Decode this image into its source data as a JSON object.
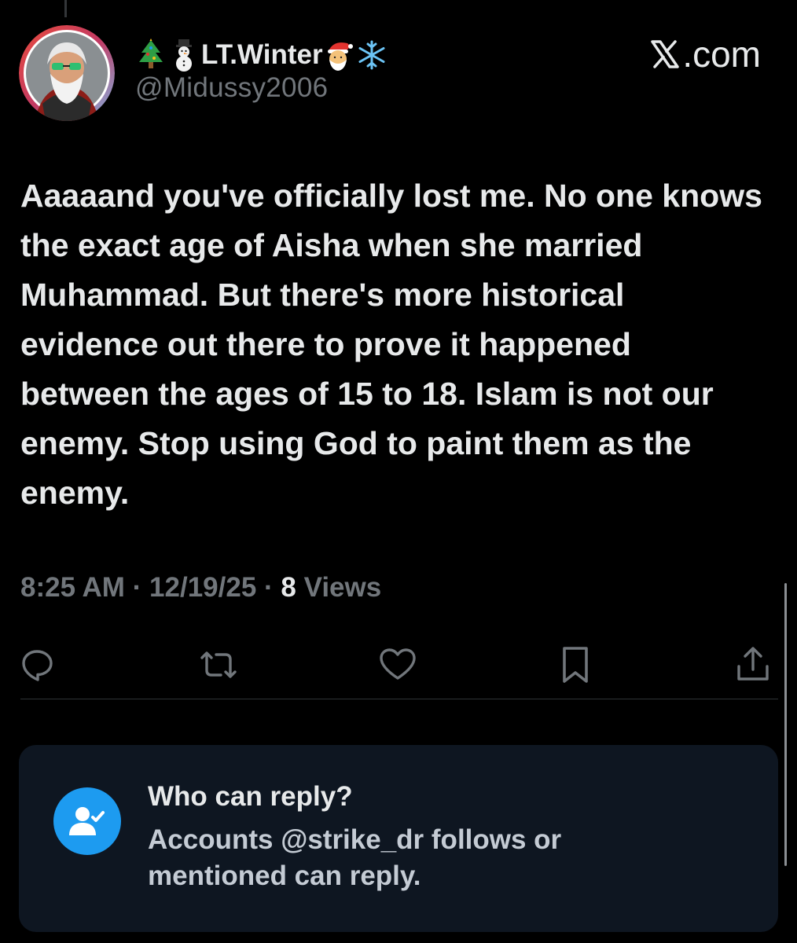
{
  "author": {
    "display_name": "LT.Winter",
    "handle": "@Midussy2006",
    "name_emojis_before": [
      "christmas-tree",
      "snowman"
    ],
    "name_emojis_after": [
      "santa-claus",
      "snowflake"
    ]
  },
  "brand": {
    "label": ".com",
    "logo_icon": "x-logo-icon"
  },
  "tweet": {
    "text": "Aaaaand you've officially lost me. No one knows the exact age of Aisha when she married Muhammad. But there's more historical evidence out there to prove it happened between the ages of 15 to 18. Islam is not our enemy. Stop using God to paint them as the enemy.",
    "time": "8:25 AM",
    "date": "12/19/25",
    "views_count": "8",
    "views_label": "Views",
    "separator": "·"
  },
  "actions": [
    {
      "name": "reply",
      "icon": "speech-bubble-icon"
    },
    {
      "name": "repost",
      "icon": "repost-arrows-icon"
    },
    {
      "name": "like",
      "icon": "heart-icon"
    },
    {
      "name": "bookmark",
      "icon": "bookmark-icon"
    },
    {
      "name": "share",
      "icon": "share-upload-icon"
    }
  ],
  "reply_settings": {
    "title": "Who can reply?",
    "body": "Accounts @strike_dr follows or mentioned can reply.",
    "icon": "person-check-icon"
  },
  "colors": {
    "background": "#000000",
    "text_primary": "#e7e9ea",
    "text_secondary": "#71767b",
    "accent": "#1d9bf0",
    "card_background": "#0e1621"
  }
}
